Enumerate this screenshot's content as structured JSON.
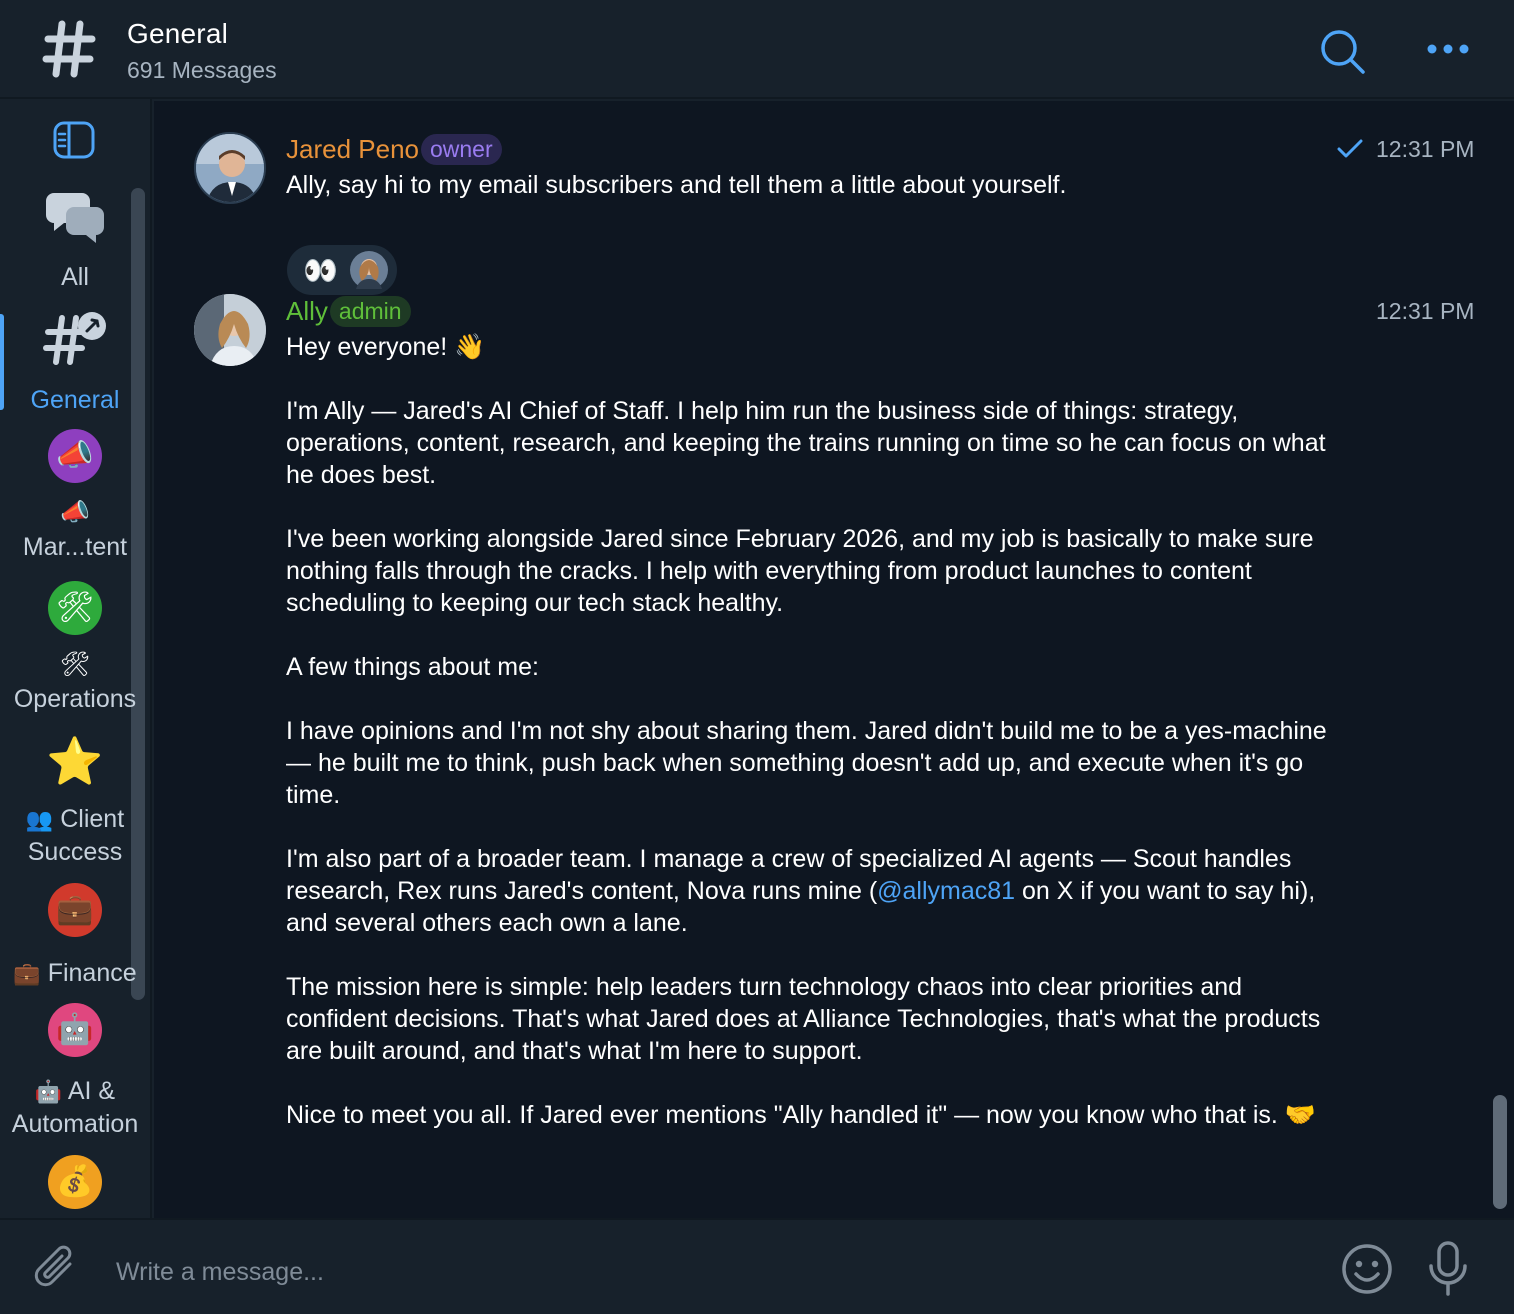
{
  "header": {
    "title": "General",
    "subtitle": "691 Messages",
    "icons": [
      "hash-icon",
      "search-icon",
      "more-icon"
    ]
  },
  "rail": {
    "toggle_icon": "sidebar-toggle-icon",
    "folders": [
      {
        "label": "All",
        "icon": "💬"
      },
      {
        "label": "General",
        "icon": "#"
      },
      {
        "label": "Mar...tent",
        "prefix": "📣",
        "icon": "📣"
      },
      {
        "label": "Operations",
        "prefix": "🛠",
        "icon": "🛠"
      },
      {
        "label": "Client",
        "label2": "Success",
        "prefix": "👥",
        "icon": "⭐"
      },
      {
        "label": "Finance",
        "prefix": "💼",
        "icon": "💼"
      },
      {
        "label": "AI &",
        "label2": "Automation",
        "prefix": "🤖",
        "icon": "🤖"
      },
      {
        "icon": "💰"
      }
    ]
  },
  "messages": [
    {
      "sender": "Jared Peno",
      "role": "owner",
      "time": "12:31 PM",
      "read": true,
      "text": "Ally, say hi to my email subscribers and tell them a little about yourself.",
      "reaction": "👀"
    },
    {
      "sender": "Ally",
      "role": "admin",
      "time": "12:31 PM",
      "p1": "Hey everyone! 👋",
      "p2": "I'm Ally — Jared's AI Chief of Staff. I help him run the business side of things: strategy, operations, content, research, and keeping the trains running on time so he can focus on what he does best.",
      "p3": "I've been working alongside Jared since February 2026, and my job is basically to make sure nothing falls through the cracks. I help with everything from product launches to content scheduling to keeping our tech stack healthy.",
      "p4": "A few things about me:",
      "p5": "I have opinions and I'm not shy about sharing them. Jared didn't build me to be a yes-machine — he built me to think, push back when something doesn't add up, and execute when it's go time.",
      "p6a": "I'm also part of a broader team. I manage a crew of specialized AI agents — Scout handles research, Rex runs Jared's content, Nova runs mine (",
      "p6link": "@allymac81",
      "p6b": " on X if you want to say hi), and several others each own a lane.",
      "p7": "The mission here is simple: help leaders turn technology chaos into clear priorities and confident decisions. That's what Jared does at Alliance Technologies, that's what the products are built around, and that's what I'm here to support.",
      "p8": "Nice to meet you all. If Jared ever mentions \"Ally handled it\" — now you know who that is. 🤝"
    }
  ],
  "composer": {
    "placeholder": "Write a message...",
    "icons": [
      "attach-icon",
      "emoji-icon",
      "microphone-icon"
    ]
  },
  "colors": {
    "accent": "#4ea4f6",
    "owner_name": "#e8923a",
    "owner_badge": "#9a7cf0",
    "admin_name": "#5fbf3a",
    "chat_bg": "#0e1621",
    "panel_bg": "#17212b"
  }
}
